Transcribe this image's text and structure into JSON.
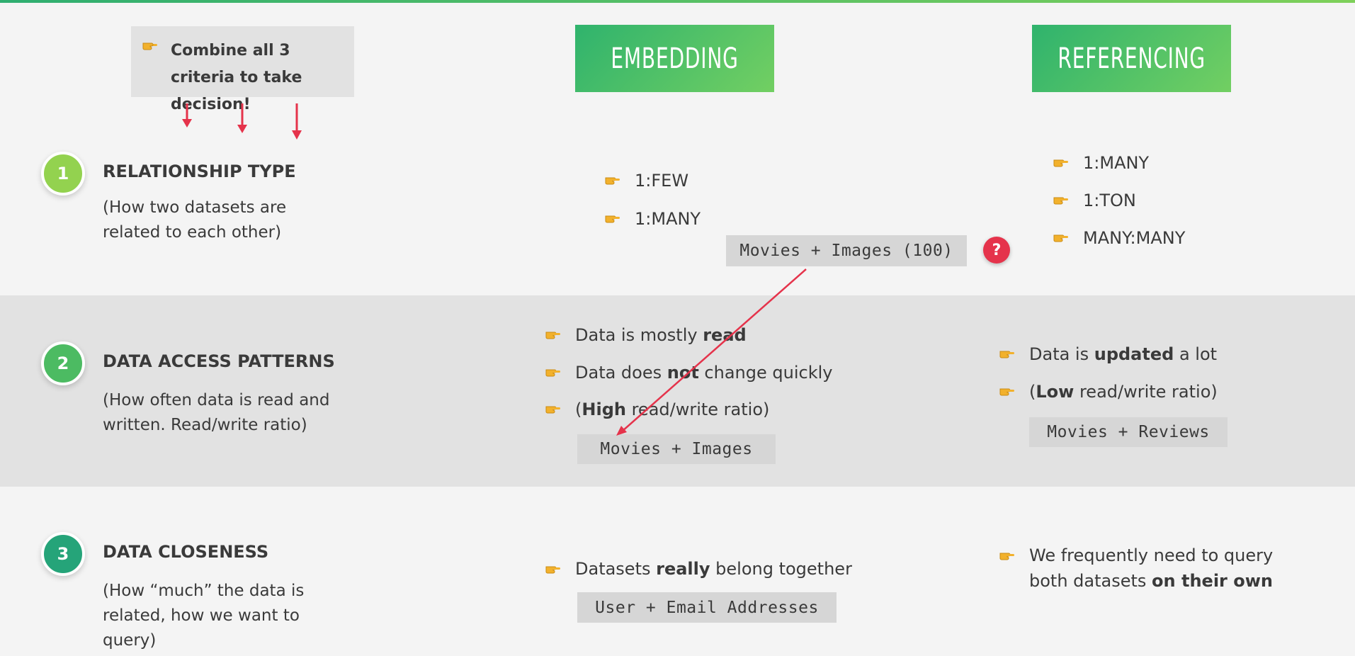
{
  "header": {
    "criteria_note": "Combine all 3 criteria to take decision!",
    "embedding_label": "EMBEDDING",
    "referencing_label": "REFERENCING"
  },
  "criteria": [
    {
      "number": "1",
      "title": "RELATIONSHIP TYPE",
      "description": "(How two datasets are related to each other)",
      "color": "#93d24f"
    },
    {
      "number": "2",
      "title": "DATA ACCESS PATTERNS",
      "description": "(How often data is read and written. Read/write ratio)",
      "color": "#4cbb62"
    },
    {
      "number": "3",
      "title": "DATA CLOSENESS",
      "description": "(How “much” the data is related, how we want to query)",
      "color": "#25a479"
    }
  ],
  "embedding": {
    "relationship": [
      "1:FEW",
      "1:MANY"
    ],
    "relationship_example": "Movies + Images (100)",
    "access": {
      "read_prefix": "Data is mostly ",
      "read_bold": "read",
      "change_prefix": "Data does ",
      "change_bold": "not",
      "change_suffix": " change quickly",
      "ratio_open": "(",
      "ratio_bold": "High",
      "ratio_suffix": " read/write ratio)"
    },
    "access_example": "Movies + Images",
    "closeness": {
      "prefix": "Datasets ",
      "bold": "really",
      "suffix": " belong together"
    },
    "closeness_example": "User + Email Addresses"
  },
  "referencing": {
    "relationship": [
      "1:MANY",
      "1:TON",
      "MANY:MANY"
    ],
    "access": {
      "updated_prefix": "Data is ",
      "updated_bold": "updated",
      "updated_suffix": " a lot",
      "ratio_open": "(",
      "ratio_bold": "Low",
      "ratio_suffix": " read/write ratio)"
    },
    "access_example": "Movies + Reviews",
    "closeness": {
      "line1": "We frequently need to query",
      "line2_prefix": "both datasets ",
      "line2_bold": "on their own"
    }
  },
  "question_mark": "?",
  "colors": {
    "accent_green": "#4cbb62",
    "arrow_red": "#e5334b",
    "hand_yellow": "#f2b12c"
  }
}
